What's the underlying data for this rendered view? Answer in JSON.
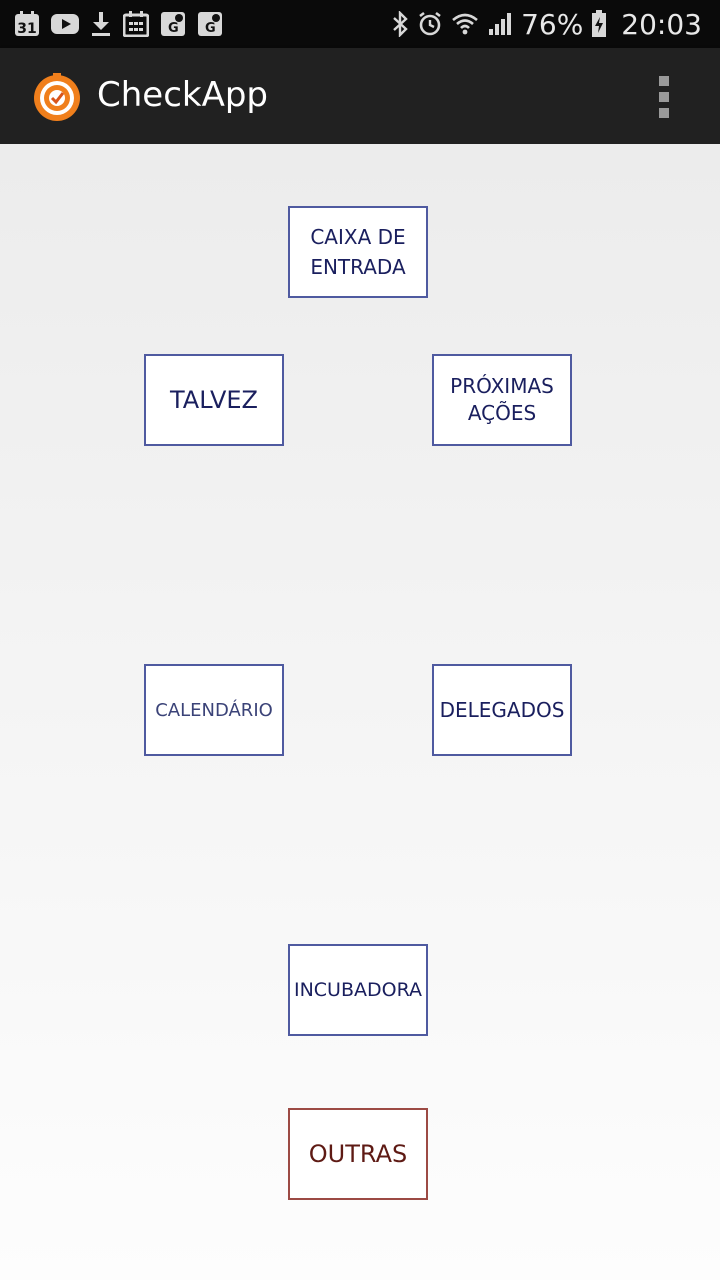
{
  "status_bar": {
    "battery_percent": "76%",
    "time": "20:03",
    "calendar_day": "31",
    "left_icons": [
      "calendar-icon",
      "youtube-icon",
      "download-icon",
      "calendar-grid-icon",
      "google-maps-icon",
      "google-maps-icon"
    ],
    "right_icons": [
      "bluetooth-icon",
      "alarm-icon",
      "wifi-icon",
      "signal-icon",
      "battery-charging-icon"
    ]
  },
  "action_bar": {
    "title": "CheckApp",
    "icon": "checkapp-logo-icon",
    "menu_icon": "overflow-menu-icon",
    "background": "#212121"
  },
  "tiles": {
    "caixa_de_entrada": "CAIXA DE\nENTRADA",
    "talvez": "TALVEZ",
    "proximas_acoes": "PRÓXIMAS\nAÇÕES",
    "calendario": "CALENDÁRIO",
    "delegados": "DELEGADOS",
    "incubadora": "INCUBADORA",
    "outras": "OUTRAS"
  },
  "colors": {
    "tile_border": "#4f5aa0",
    "tile_text": "#1a1f5e",
    "outras_border": "#9c4a44",
    "outras_text": "#5e1a14"
  }
}
